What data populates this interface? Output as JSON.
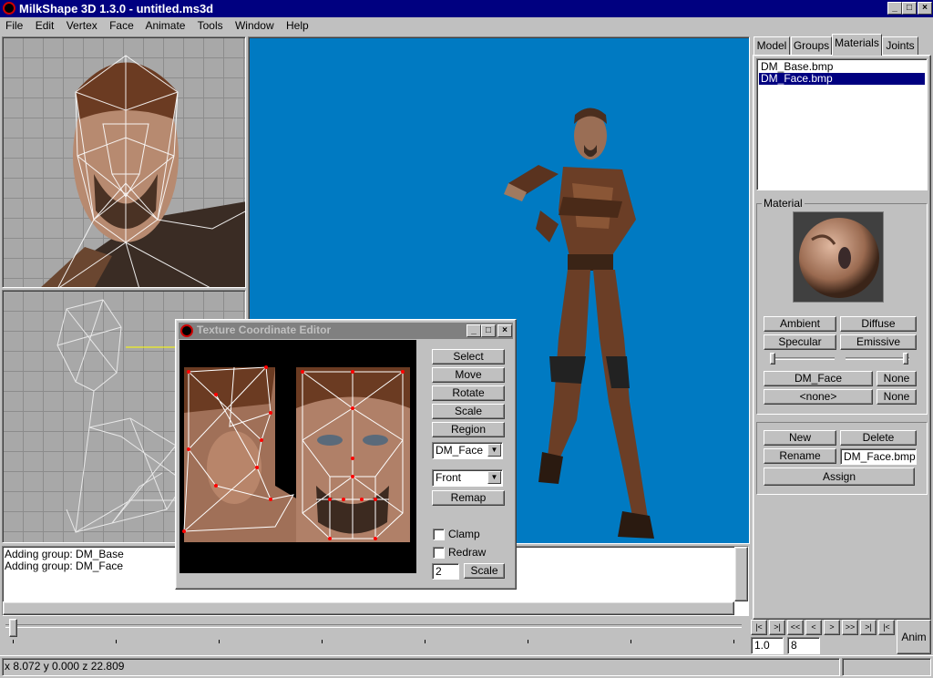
{
  "window": {
    "title": "MilkShape 3D 1.3.0 - untitled.ms3d"
  },
  "menu": [
    "File",
    "Edit",
    "Vertex",
    "Face",
    "Animate",
    "Tools",
    "Window",
    "Help"
  ],
  "tabs": [
    "Model",
    "Groups",
    "Materials",
    "Joints"
  ],
  "materials_list": [
    "DM_Base.bmp",
    "DM_Face.bmp"
  ],
  "material_panel": {
    "group_label": "Material",
    "ambient": "Ambient",
    "diffuse": "Diffuse",
    "specular": "Specular",
    "emissive": "Emissive",
    "texture1": "DM_Face",
    "texture1_none": "None",
    "texture2": "<none>",
    "texture2_none": "None"
  },
  "material_actions": {
    "new": "New",
    "delete": "Delete",
    "rename": "Rename",
    "name_value": "DM_Face.bmp",
    "assign": "Assign"
  },
  "log": [
    "Adding group: DM_Base",
    "Adding group: DM_Face"
  ],
  "tex_editor": {
    "title": "Texture Coordinate Editor",
    "select": "Select",
    "move": "Move",
    "rotate": "Rotate",
    "scale": "Scale",
    "region": "Region",
    "group_value": "DM_Face",
    "view_value": "Front",
    "remap": "Remap",
    "clamp": "Clamp",
    "redraw": "Redraw",
    "scale_value": "2",
    "scale_btn": "Scale"
  },
  "anim": {
    "frame": "1.0",
    "total": "8",
    "anim_btn": "Anim",
    "nav": [
      "|<",
      ">|",
      "<<",
      "<",
      ">",
      ">>",
      ">|",
      "|<"
    ]
  },
  "status": {
    "coords": "x 8.072 y 0.000 z 22.809"
  },
  "colors": {
    "titlebar": "#000080",
    "viewport_bg": "#007ac2",
    "select": "#000080"
  }
}
